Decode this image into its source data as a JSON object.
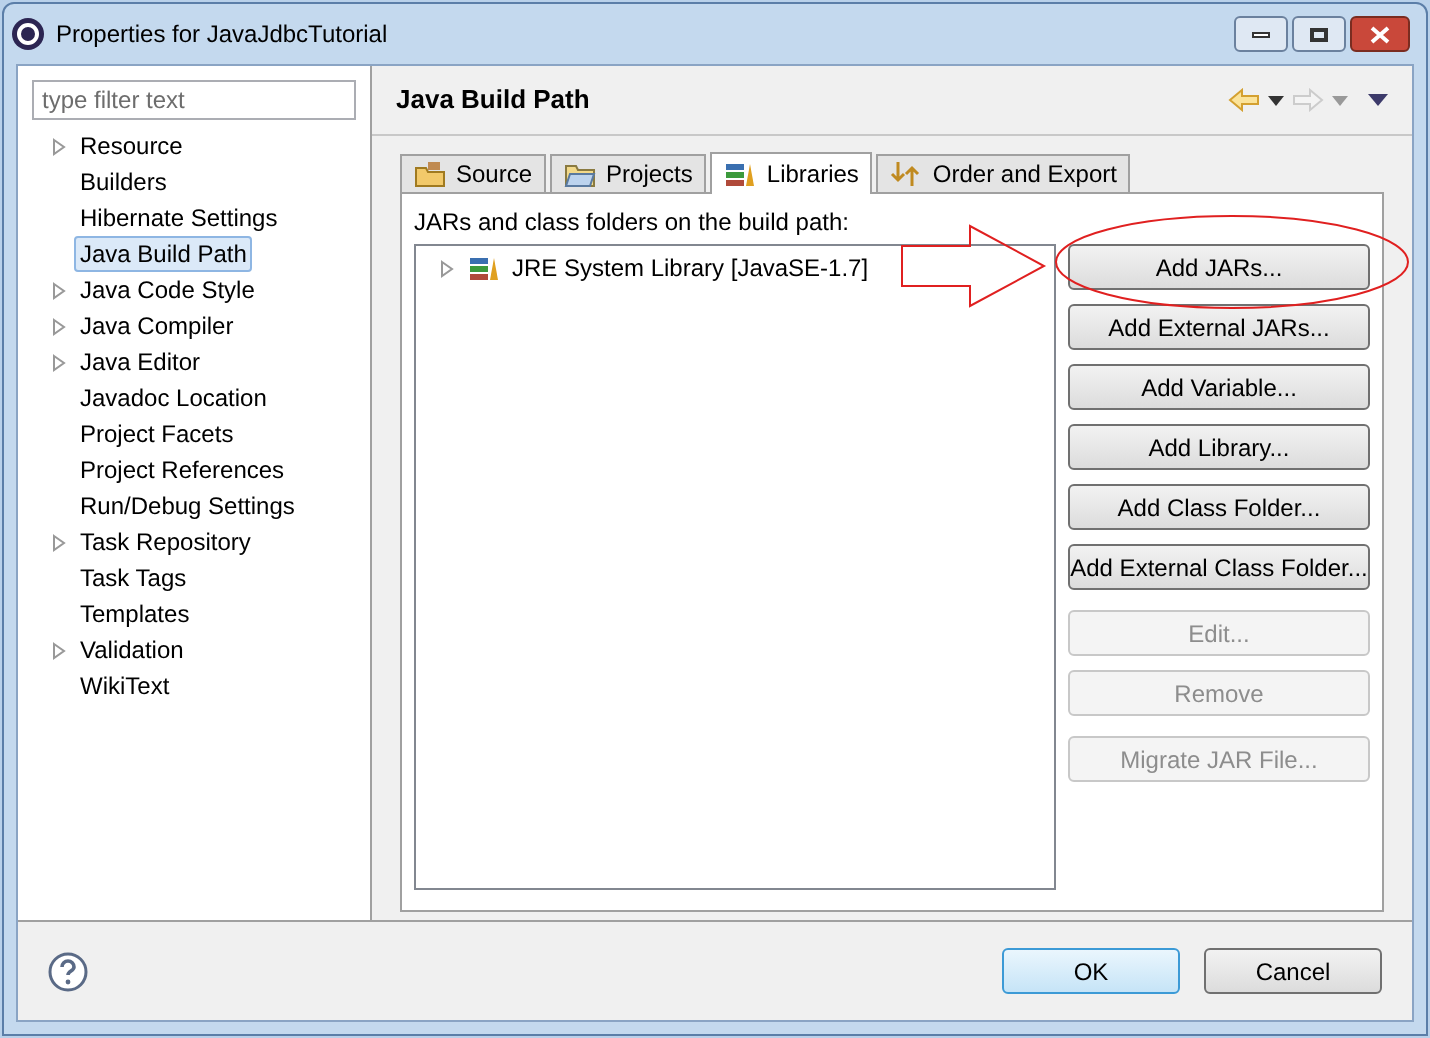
{
  "window": {
    "title": "Properties for JavaJdbcTutorial"
  },
  "filter": {
    "placeholder": "type filter text"
  },
  "sidebar": {
    "items": [
      {
        "label": "Resource",
        "expandable": true,
        "selected": false
      },
      {
        "label": "Builders",
        "expandable": false,
        "selected": false
      },
      {
        "label": "Hibernate Settings",
        "expandable": false,
        "selected": false
      },
      {
        "label": "Java Build Path",
        "expandable": false,
        "selected": true
      },
      {
        "label": "Java Code Style",
        "expandable": true,
        "selected": false
      },
      {
        "label": "Java Compiler",
        "expandable": true,
        "selected": false
      },
      {
        "label": "Java Editor",
        "expandable": true,
        "selected": false
      },
      {
        "label": "Javadoc Location",
        "expandable": false,
        "selected": false
      },
      {
        "label": "Project Facets",
        "expandable": false,
        "selected": false
      },
      {
        "label": "Project References",
        "expandable": false,
        "selected": false
      },
      {
        "label": "Run/Debug Settings",
        "expandable": false,
        "selected": false
      },
      {
        "label": "Task Repository",
        "expandable": true,
        "selected": false
      },
      {
        "label": "Task Tags",
        "expandable": false,
        "selected": false
      },
      {
        "label": "Templates",
        "expandable": false,
        "selected": false
      },
      {
        "label": "Validation",
        "expandable": true,
        "selected": false
      },
      {
        "label": "WikiText",
        "expandable": false,
        "selected": false
      }
    ]
  },
  "page": {
    "title": "Java Build Path",
    "tabs": [
      {
        "label": "Source",
        "kind": "source",
        "selected": false
      },
      {
        "label": "Projects",
        "kind": "projects",
        "selected": false
      },
      {
        "label": "Libraries",
        "kind": "libraries",
        "selected": true
      },
      {
        "label": "Order and Export",
        "kind": "order",
        "selected": false
      }
    ],
    "list_label": "JARs and class folders on the build path:",
    "tree": [
      {
        "label": "JRE System Library [JavaSE-1.7]",
        "expanded": false
      }
    ],
    "button_groups": [
      [
        {
          "label": "Add JARs...",
          "disabled": false
        },
        {
          "label": "Add External JARs...",
          "disabled": false
        },
        {
          "label": "Add Variable...",
          "disabled": false
        },
        {
          "label": "Add Library...",
          "disabled": false
        },
        {
          "label": "Add Class Folder...",
          "disabled": false
        },
        {
          "label": "Add External Class Folder...",
          "disabled": false
        }
      ],
      [
        {
          "label": "Edit...",
          "disabled": true
        },
        {
          "label": "Remove",
          "disabled": true
        }
      ],
      [
        {
          "label": "Migrate JAR File...",
          "disabled": true
        }
      ]
    ]
  },
  "footer": {
    "buttons": [
      {
        "label": "OK",
        "default": true
      },
      {
        "label": "Cancel",
        "default": false
      }
    ]
  }
}
